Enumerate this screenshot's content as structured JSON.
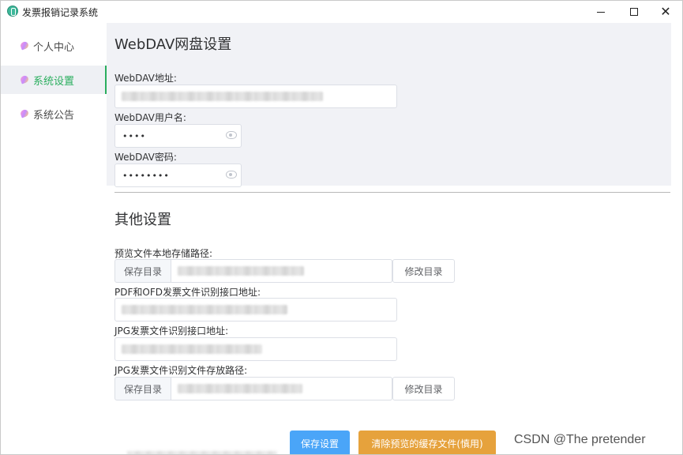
{
  "window": {
    "title": "发票报销记录系统",
    "close_glyph": "✕"
  },
  "sidebar": {
    "items": [
      {
        "label": "个人中心",
        "icon": "paint-stroke-icon",
        "active": false
      },
      {
        "label": "系统设置",
        "icon": "paint-stroke-icon",
        "active": true
      },
      {
        "label": "系统公告",
        "icon": "paint-stroke-icon",
        "active": false
      }
    ]
  },
  "webdav": {
    "section_title": "WebDAV网盘设置",
    "address_label": "WebDAV地址:",
    "username_label": "WebDAV用户名:",
    "username_value": "••••",
    "password_label": "WebDAV密码:",
    "password_value": "••••••••"
  },
  "other": {
    "section_title": "其他设置",
    "preview_path_label": "预览文件本地存储路径:",
    "preview_prepend": "保存目录",
    "preview_change_button": "修改目录",
    "pdf_ofd_label": "PDF和OFD发票文件识别接口地址:",
    "jpg_api_label": "JPG发票文件识别接口地址:",
    "jpg_path_label": "JPG发票文件识别文件存放路径:",
    "jpg_prepend": "保存目录",
    "jpg_change_button": "修改目录"
  },
  "actions": {
    "save_button": "保存设置",
    "clear_button": "清除预览的缓存文件(慎用)"
  },
  "watermark": "CSDN @The  pretender",
  "colors": {
    "accent_green": "#2aae5e",
    "primary_blue": "#4aa5f8",
    "warning_orange": "#e6a23c",
    "panel_gray": "#f1f2f6"
  }
}
